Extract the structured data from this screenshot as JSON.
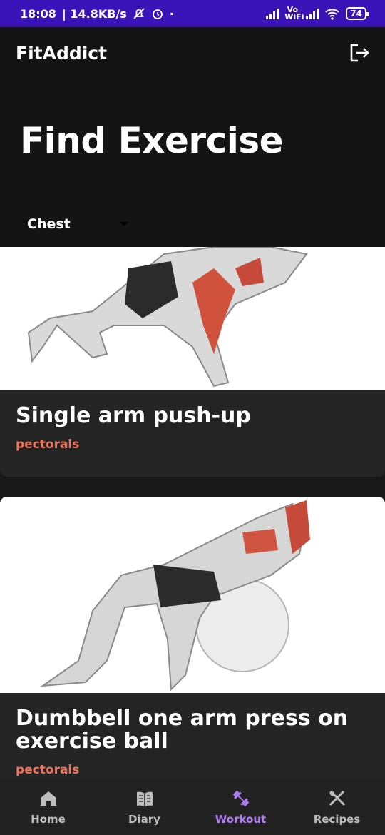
{
  "status_bar": {
    "time": "18:08",
    "speed": "| 14.8KB/s",
    "dot": "·",
    "vowifi": "Vo WiFi",
    "battery": "74"
  },
  "header": {
    "app_title": "FitAddict",
    "page_title": "Find Exercise",
    "category_value": "Chest"
  },
  "exercises": [
    {
      "name": "Single arm push-up",
      "target": "pectorals"
    },
    {
      "name": "Dumbbell one arm press on exercise ball",
      "target": "pectorals"
    }
  ],
  "nav": {
    "items": [
      {
        "label": "Home",
        "icon": "home-icon"
      },
      {
        "label": "Diary",
        "icon": "book-icon"
      },
      {
        "label": "Workout",
        "icon": "dumbbell-icon"
      },
      {
        "label": "Recipes",
        "icon": "utensils-icon"
      }
    ],
    "active": "Workout"
  },
  "colors": {
    "status_bar": "#3a14b8",
    "header_bg": "#141414",
    "card_bg": "#242424",
    "target_text": "#f0735a",
    "nav_active": "#b07ef0"
  }
}
